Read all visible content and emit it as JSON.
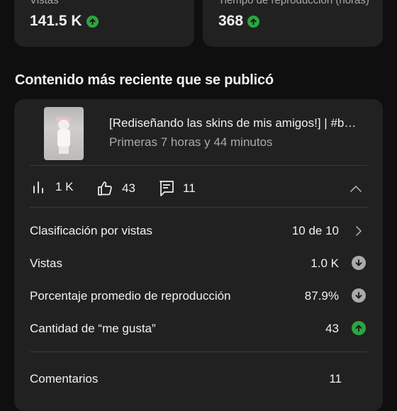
{
  "summary_cards": [
    {
      "label": "Vistas",
      "value": "141.5 K"
    },
    {
      "label": "Tiempo de reproducción (horas)",
      "value": "368"
    }
  ],
  "section_title": "Contenido más reciente que se publicó",
  "latest_video": {
    "title": "[Rediseñando las skins de mis amigos!] | #b…",
    "subtitle": "Primeras 7 horas y 44 minutos",
    "stats": {
      "views": "1 K",
      "likes": "43",
      "comments": "11"
    }
  },
  "metrics": [
    {
      "label": "Clasificación por vistas",
      "value": "10 de 10",
      "indicator": "chevron-right"
    },
    {
      "label": "Vistas",
      "value": "1.0 K",
      "indicator": "down"
    },
    {
      "label": "Porcentaje promedio de reproducción",
      "value": "87.9%",
      "indicator": "down"
    },
    {
      "label": "Cantidad de “me gusta”",
      "value": "43",
      "indicator": "up"
    },
    {
      "label": "Comentarios",
      "value": "11",
      "indicator": "none"
    }
  ],
  "colors": {
    "background": "#0f0f0f",
    "card": "#212121",
    "up": "#2ba640",
    "down": "#aaaaaa",
    "muted_text": "#aaaaaa"
  }
}
